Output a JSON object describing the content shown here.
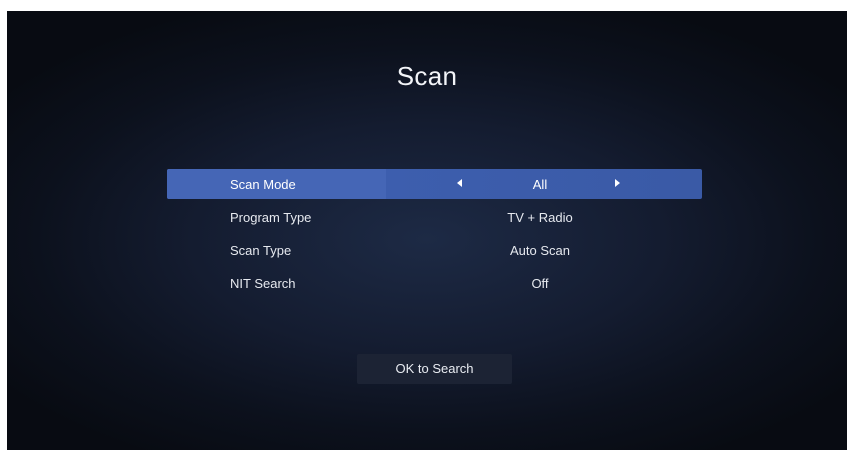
{
  "screen": {
    "title": "Scan"
  },
  "menu": {
    "items": [
      {
        "label": "Scan Mode",
        "value": "All"
      },
      {
        "label": "Program Type",
        "value": "TV + Radio"
      },
      {
        "label": "Scan Type",
        "value": "Auto Scan"
      },
      {
        "label": "NIT Search",
        "value": "Off"
      }
    ],
    "selected_index": 0
  },
  "actions": {
    "ok_label": "OK to Search"
  },
  "colors": {
    "selection": "#3d5eae",
    "background": "#141c30",
    "text": "#e6e9ef"
  },
  "icons": {
    "left": "caret-left-icon",
    "right": "caret-right-icon"
  }
}
